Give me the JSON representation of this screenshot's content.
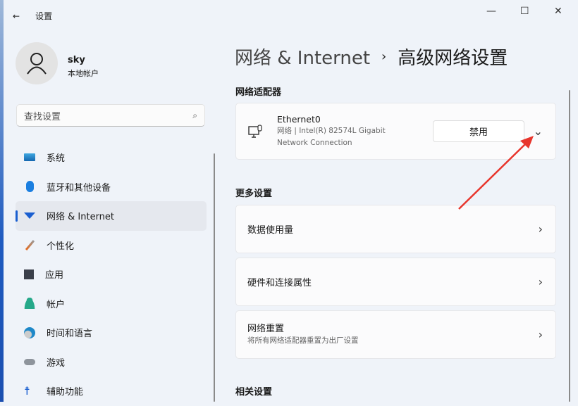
{
  "window": {
    "title": "设置",
    "back": "←",
    "minimize": "—",
    "maximize": "☐",
    "close": "✕"
  },
  "user": {
    "name": "sky",
    "type": "本地帐户"
  },
  "search": {
    "placeholder": "查找设置"
  },
  "nav": [
    {
      "label": "系统",
      "icon": "monitor-icon"
    },
    {
      "label": "蓝牙和其他设备",
      "icon": "bluetooth-icon"
    },
    {
      "label": "网络 & Internet",
      "icon": "wifi-icon"
    },
    {
      "label": "个性化",
      "icon": "brush-icon"
    },
    {
      "label": "应用",
      "icon": "apps-icon"
    },
    {
      "label": "帐户",
      "icon": "person-icon"
    },
    {
      "label": "时间和语言",
      "icon": "clock-globe-icon"
    },
    {
      "label": "游戏",
      "icon": "gamepad-icon"
    },
    {
      "label": "辅助功能",
      "icon": "accessibility-icon"
    }
  ],
  "breadcrumb": {
    "parent": "网络 & Internet",
    "sep": "›",
    "current": "高级网络设置"
  },
  "adapters": {
    "title": "网络适配器",
    "name": "Ethernet0",
    "desc1": "网络 | Intel(R) 82574L Gigabit",
    "desc2": "Network Connection",
    "disable": "禁用"
  },
  "more": {
    "title": "更多设置",
    "items": [
      {
        "label": "数据使用量"
      },
      {
        "label": "硬件和连接属性"
      },
      {
        "label": "网络重置",
        "sub": "将所有网络适配器重置为出厂设置"
      }
    ]
  },
  "related": {
    "title": "相关设置"
  },
  "colors": {
    "accent": "#1a5fd0",
    "arrow": "#e8352c"
  }
}
